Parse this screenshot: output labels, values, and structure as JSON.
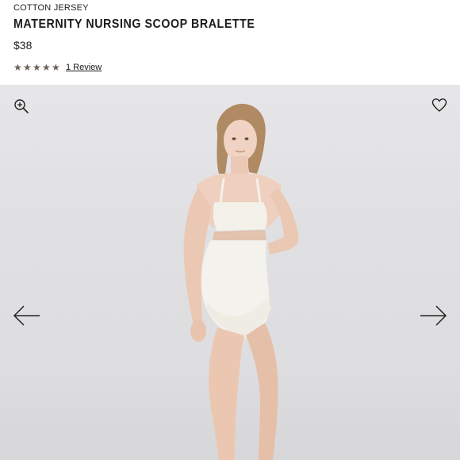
{
  "product": {
    "collection": "COTTON JERSEY",
    "title": "MATERNITY NURSING SCOOP BRALETTE",
    "price": "$38",
    "rating_value": 5,
    "rating_max": 5,
    "review_link": "1 Review"
  },
  "gallery": {
    "icons": {
      "zoom": "zoom-in-icon",
      "favorite": "heart-icon",
      "prev": "arrow-left-icon",
      "next": "arrow-right-icon"
    },
    "image_alt": "Model wearing maternity nursing scoop bralette"
  },
  "colors": {
    "star": "#6b6157",
    "background": "#e1e1e3",
    "garment": "#f3f1ea"
  }
}
